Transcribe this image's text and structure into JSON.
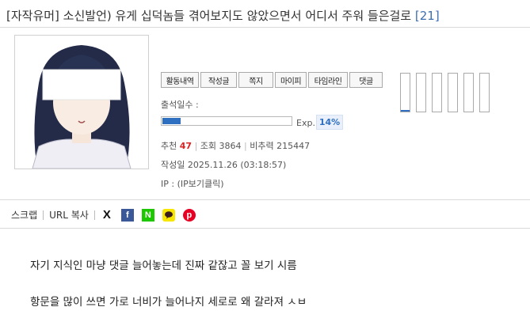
{
  "post": {
    "title": "[자작유머] 소신발언) 유게 십덕놈들 겪어보지도 않았으면서 어디서 주워 들은걸로",
    "comment_count": "[21]"
  },
  "profile": {
    "buttons": [
      "활동내역",
      "작성글",
      "쪽지",
      "마이피",
      "타임라인",
      "댓글"
    ],
    "attendance_label": "출석일수 :",
    "exp_label": "Exp.",
    "exp_percent": "14%",
    "exp_progress": 0.14,
    "gauge_levels": [
      0.04,
      0,
      0,
      0,
      0,
      0
    ]
  },
  "stats": {
    "recommend_label": "추천",
    "recommend_value": "47",
    "views_label": "조회",
    "views_value": "3864",
    "ratio_label": "비추력",
    "ratio_value": "215447",
    "date_label": "작성일",
    "date_value": "2025.11.26 (03:18:57)",
    "ip_label": "IP :",
    "ip_value": "(IP보기클릭)"
  },
  "share": {
    "scrap": "스크랩",
    "url_copy": "URL 복사",
    "icons": [
      "x-icon",
      "facebook-icon",
      "naver-icon",
      "kakaotalk-icon",
      "pinterest-icon"
    ],
    "x_glyph": "X",
    "facebook_glyph": "f",
    "naver_glyph": "N",
    "pinterest_glyph": "p"
  },
  "body_lines": [
    "자기 지식인 마냥 댓글 늘어놓는데 진짜 같잖고 꼴 보기 시름",
    "항문을 많이 쓰면 가로 너비가 늘어나지 세로로 왜 갈라져 ㅅㅂ"
  ],
  "colors": {
    "accent": "#2f6fc2",
    "recommend": "#dd2222",
    "facebook": "#3b5998",
    "naver": "#1ec800",
    "kakao": "#f7e600",
    "pinterest": "#e60023"
  }
}
